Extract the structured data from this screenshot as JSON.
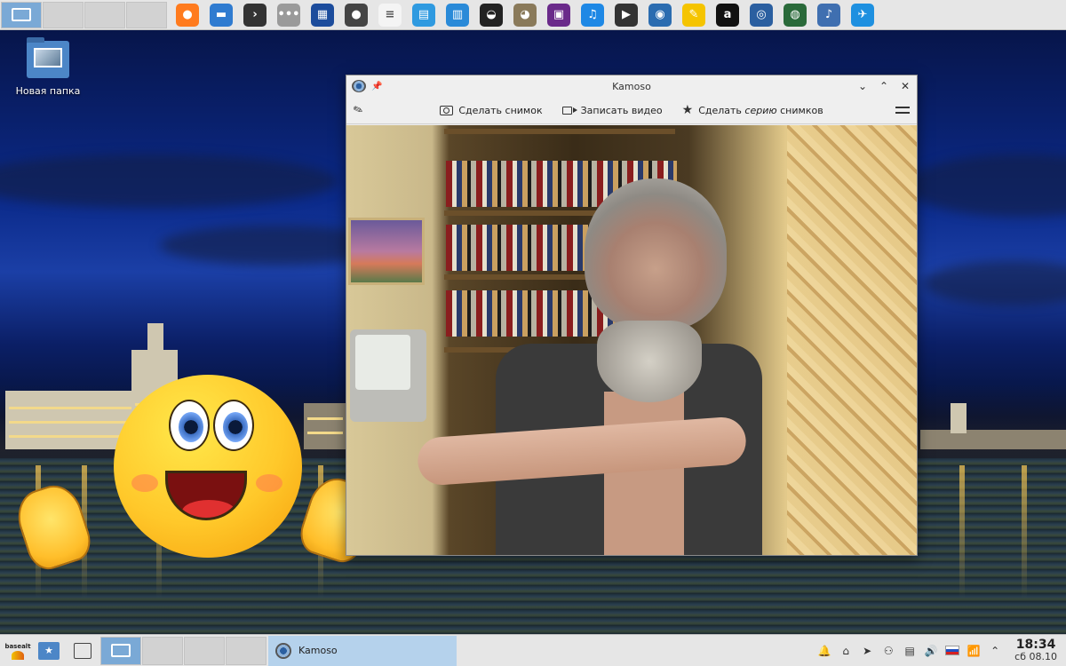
{
  "top_panel": {
    "launchers": [
      {
        "name": "firefox-icon",
        "color": "#ff7b1e",
        "glyph": "●"
      },
      {
        "name": "file-manager-icon",
        "color": "#2f7bd0",
        "glyph": "▬"
      },
      {
        "name": "terminal-icon",
        "color": "#333333",
        "glyph": "›"
      },
      {
        "name": "more-apps-icon",
        "color": "#9a9a9a",
        "glyph": "•••"
      },
      {
        "name": "calculator-icon",
        "color": "#1c4c9c",
        "glyph": "▦"
      },
      {
        "name": "circle-app-icon",
        "color": "#444444",
        "glyph": "●"
      },
      {
        "name": "text-editor-icon",
        "color": "#f4f4f4",
        "glyph": "≡"
      },
      {
        "name": "document-viewer-icon",
        "color": "#2f9ae0",
        "glyph": "▤"
      },
      {
        "name": "writer-icon",
        "color": "#2a8ad8",
        "glyph": "▥"
      },
      {
        "name": "soccer-icon",
        "color": "#222222",
        "glyph": "◒"
      },
      {
        "name": "gimp-icon",
        "color": "#8a7a5a",
        "glyph": "◕"
      },
      {
        "name": "media-app-icon",
        "color": "#6a2a8a",
        "glyph": "▣"
      },
      {
        "name": "audio-player-icon",
        "color": "#1e88e5",
        "glyph": "♫"
      },
      {
        "name": "video-editor-icon",
        "color": "#333333",
        "glyph": "▶"
      },
      {
        "name": "screenshot-icon",
        "color": "#2b6cb0",
        "glyph": "◉"
      },
      {
        "name": "notes-icon",
        "color": "#f5c400",
        "glyph": "✎"
      },
      {
        "name": "a-app-icon",
        "color": "#111111",
        "glyph": "a"
      },
      {
        "name": "webcam-icon",
        "color": "#2b5fa0",
        "glyph": "◎"
      },
      {
        "name": "globe-icon",
        "color": "#2a6a3a",
        "glyph": "◍"
      },
      {
        "name": "player-app-icon",
        "color": "#3f6fb0",
        "glyph": "♪"
      },
      {
        "name": "browser-icon",
        "color": "#1e90e0",
        "glyph": "✈"
      }
    ]
  },
  "desktop": {
    "folder_label": "Новая папка"
  },
  "window": {
    "title": "Kamoso",
    "toolbar": {
      "take_photo": "Сделать снимок",
      "record_video": "Записать видео",
      "burst_prefix": "Сделать ",
      "burst_italic": "серию",
      "burst_suffix": " снимков"
    }
  },
  "bottom_panel": {
    "task_label": "Kamoso",
    "logo_top": "basealt",
    "clock_time": "18:34",
    "clock_date": "сб 08.10"
  }
}
